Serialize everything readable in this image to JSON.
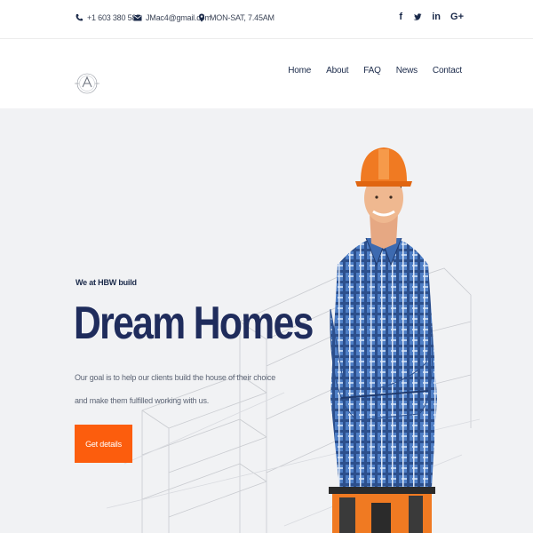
{
  "topbar": {
    "phone": "+1 603 380 585",
    "email": "JMac4@gmail.com",
    "hours": "MON-SAT, 7.45AM",
    "social": [
      {
        "icon": "facebook-icon",
        "glyph": "f"
      },
      {
        "icon": "twitter-icon",
        "glyph": "❧"
      },
      {
        "icon": "linkedin-icon",
        "glyph": "in"
      },
      {
        "icon": "google-plus-icon",
        "glyph": "G+"
      }
    ]
  },
  "nav": {
    "items": [
      "Home",
      "About",
      "FAQ",
      "News",
      "Contact"
    ]
  },
  "hero": {
    "tagline": "We at HBW build",
    "headline": "Dream Homes",
    "description_line1": "Our goal is to help our clients build the house of their choice",
    "description_line2": "and make them fulfilled working with us.",
    "cta_label": "Get details"
  },
  "colors": {
    "accent": "#fc5d0d",
    "navy": "#1f2c5c",
    "hero_bg": "#f1f2f4"
  }
}
